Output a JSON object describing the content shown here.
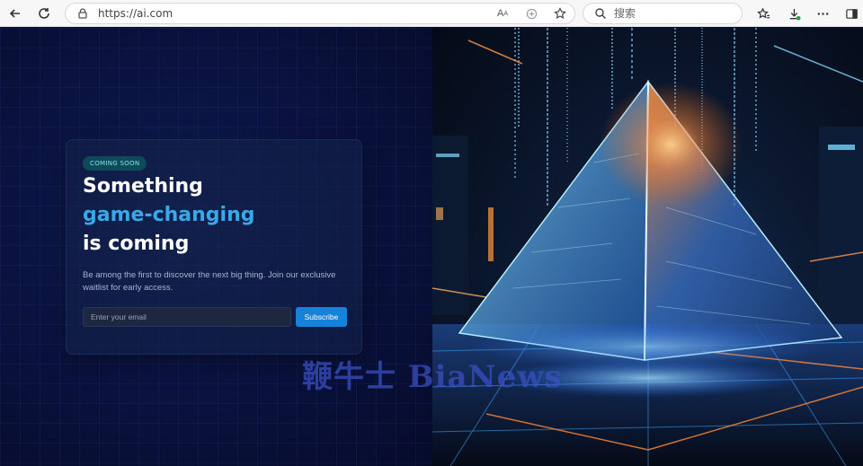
{
  "browser": {
    "url": "https://ai.com",
    "search_placeholder": "搜索",
    "icons": [
      "back-icon",
      "refresh-icon",
      "lock-icon",
      "read-aloud-icon",
      "translate-icon",
      "favorite-star-icon",
      "search-icon",
      "favorites-icon",
      "downloads-icon",
      "more-icon",
      "sidebar-icon"
    ]
  },
  "hero": {
    "badge": "COMING SOON",
    "title_line1": "Something",
    "title_line2": "game-changing",
    "title_line3": "is coming",
    "description": "Be among the first to discover the next big thing. Join our exclusive waitlist for early access.",
    "email_placeholder": "Enter your email",
    "subscribe_label": "Subscribe"
  },
  "watermark": "鞭牛士 BiaNews",
  "colors": {
    "accent": "#3aa8e8",
    "button": "#1682d8",
    "background": "#0a1340",
    "badge_bg": "#0e4b5a"
  }
}
